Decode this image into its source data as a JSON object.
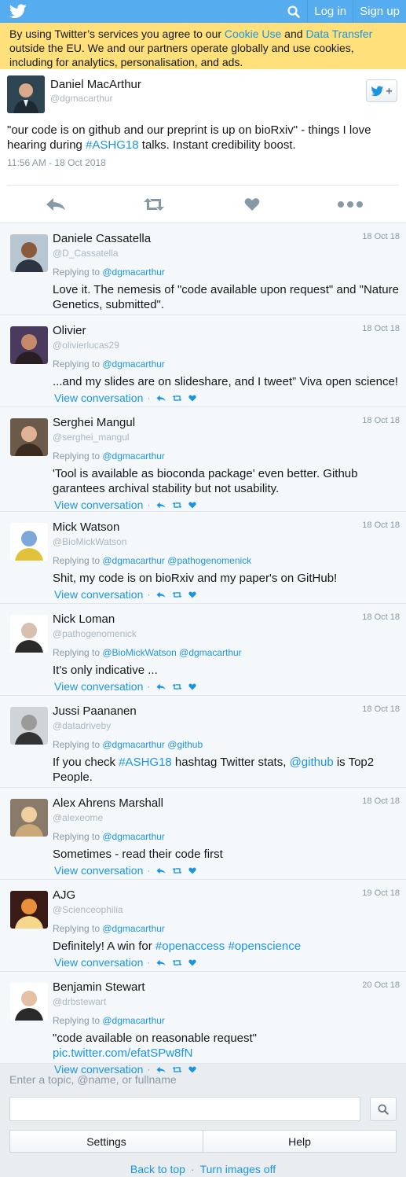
{
  "colors": {
    "brand": "#55acee",
    "link": "#1b95e0",
    "cookie_bg": "#ffe07a"
  },
  "topbar": {
    "logo_icon": "twitter-bird-icon",
    "search_icon": "search-icon",
    "login_label": "Log in",
    "signup_label": "Sign up"
  },
  "cookie": {
    "part1": "By using Twitter’s services you agree to our ",
    "cookie_link": "Cookie Use",
    "part2": " and ",
    "transfer_link": "Data Transfer",
    "part3": " outside the EU. We and our partners operate globally and use cookies, including for analytics, personalisation, and ads."
  },
  "main_tweet": {
    "name": "Daniel MacArthur",
    "handle": "@dgmacarthur",
    "text_before": "\"our code is on github and our preprint is up on bioRxiv\" - things I love hearing during ",
    "hashtag": "#ASHG18",
    "text_after": " talks. Instant credibility boost.",
    "time": "11:56 AM - 18 Oct 2018"
  },
  "view_conversation": "View conversation",
  "replying_to": "Replying to ",
  "replies": [
    {
      "name": "Daniele Cassatella",
      "handle": "@D_Cassatella",
      "date": "18 Oct 18",
      "reply_to": "@dgmacarthur",
      "text": "Love it. The nemesis of \"code available upon request\" and \"Nature Genetics, submitted\"."
    },
    {
      "name": "Olivier",
      "handle": "@olivierlucas29",
      "date": "18 Oct 18",
      "reply_to": "@dgmacarthur",
      "text": "...and my slides are on slideshare, and I tweet” Viva open science!"
    },
    {
      "name": "Serghei Mangul",
      "handle": "@serghei_mangul",
      "date": "18 Oct 18",
      "reply_to": "@dgmacarthur",
      "text": "'Tool is available as bioconda package' even better. Github garantees archival stability but not usability."
    },
    {
      "name": "Mick Watson",
      "handle": "@BioMickWatson",
      "date": "18 Oct 18",
      "reply_to": "@dgmacarthur @pathogenomenick",
      "text": "Shit, my code is on bioRxiv and my paper's on GitHub!"
    },
    {
      "name": "Nick Loman",
      "handle": "@pathogenomenick",
      "date": "18 Oct 18",
      "reply_to": "@BioMickWatson @dgmacarthur",
      "text": "It's only indicative ..."
    },
    {
      "name": "Jussi Paananen",
      "handle": "@datadriveby",
      "date": "18 Oct 18",
      "reply_to": "@dgmacarthur @github",
      "text_parts": [
        "If you check ",
        "#ASHG18",
        " hashtag Twitter stats, ",
        "@github",
        " is Top2 People."
      ]
    },
    {
      "name": "Alex Ahrens Marshall",
      "handle": "@alexeome",
      "date": "18 Oct 18",
      "reply_to": "@dgmacarthur",
      "text": "Sometimes - read their code first"
    },
    {
      "name": "AJG",
      "handle": "@Scienceophilia",
      "date": "19 Oct 18",
      "reply_to": "@dgmacarthur",
      "text_parts": [
        "Definitely! A win for ",
        "#openaccess",
        " ",
        "#openscience",
        ""
      ]
    },
    {
      "name": "Benjamin Stewart",
      "handle": "@drbstewart",
      "date": "20 Oct 18",
      "reply_to": "@dgmacarthur",
      "text_parts": [
        "\"code available on reasonable request\" ",
        "pic.twitter.com/efatSPw8fN",
        "",
        "",
        ""
      ]
    }
  ],
  "bottom": {
    "search_label": "Enter a topic, @name, or fullname",
    "search_value": "",
    "settings_label": "Settings",
    "help_label": "Help",
    "back_to_top": "Back to top",
    "images_off": "Turn images off",
    "separator": "·"
  }
}
